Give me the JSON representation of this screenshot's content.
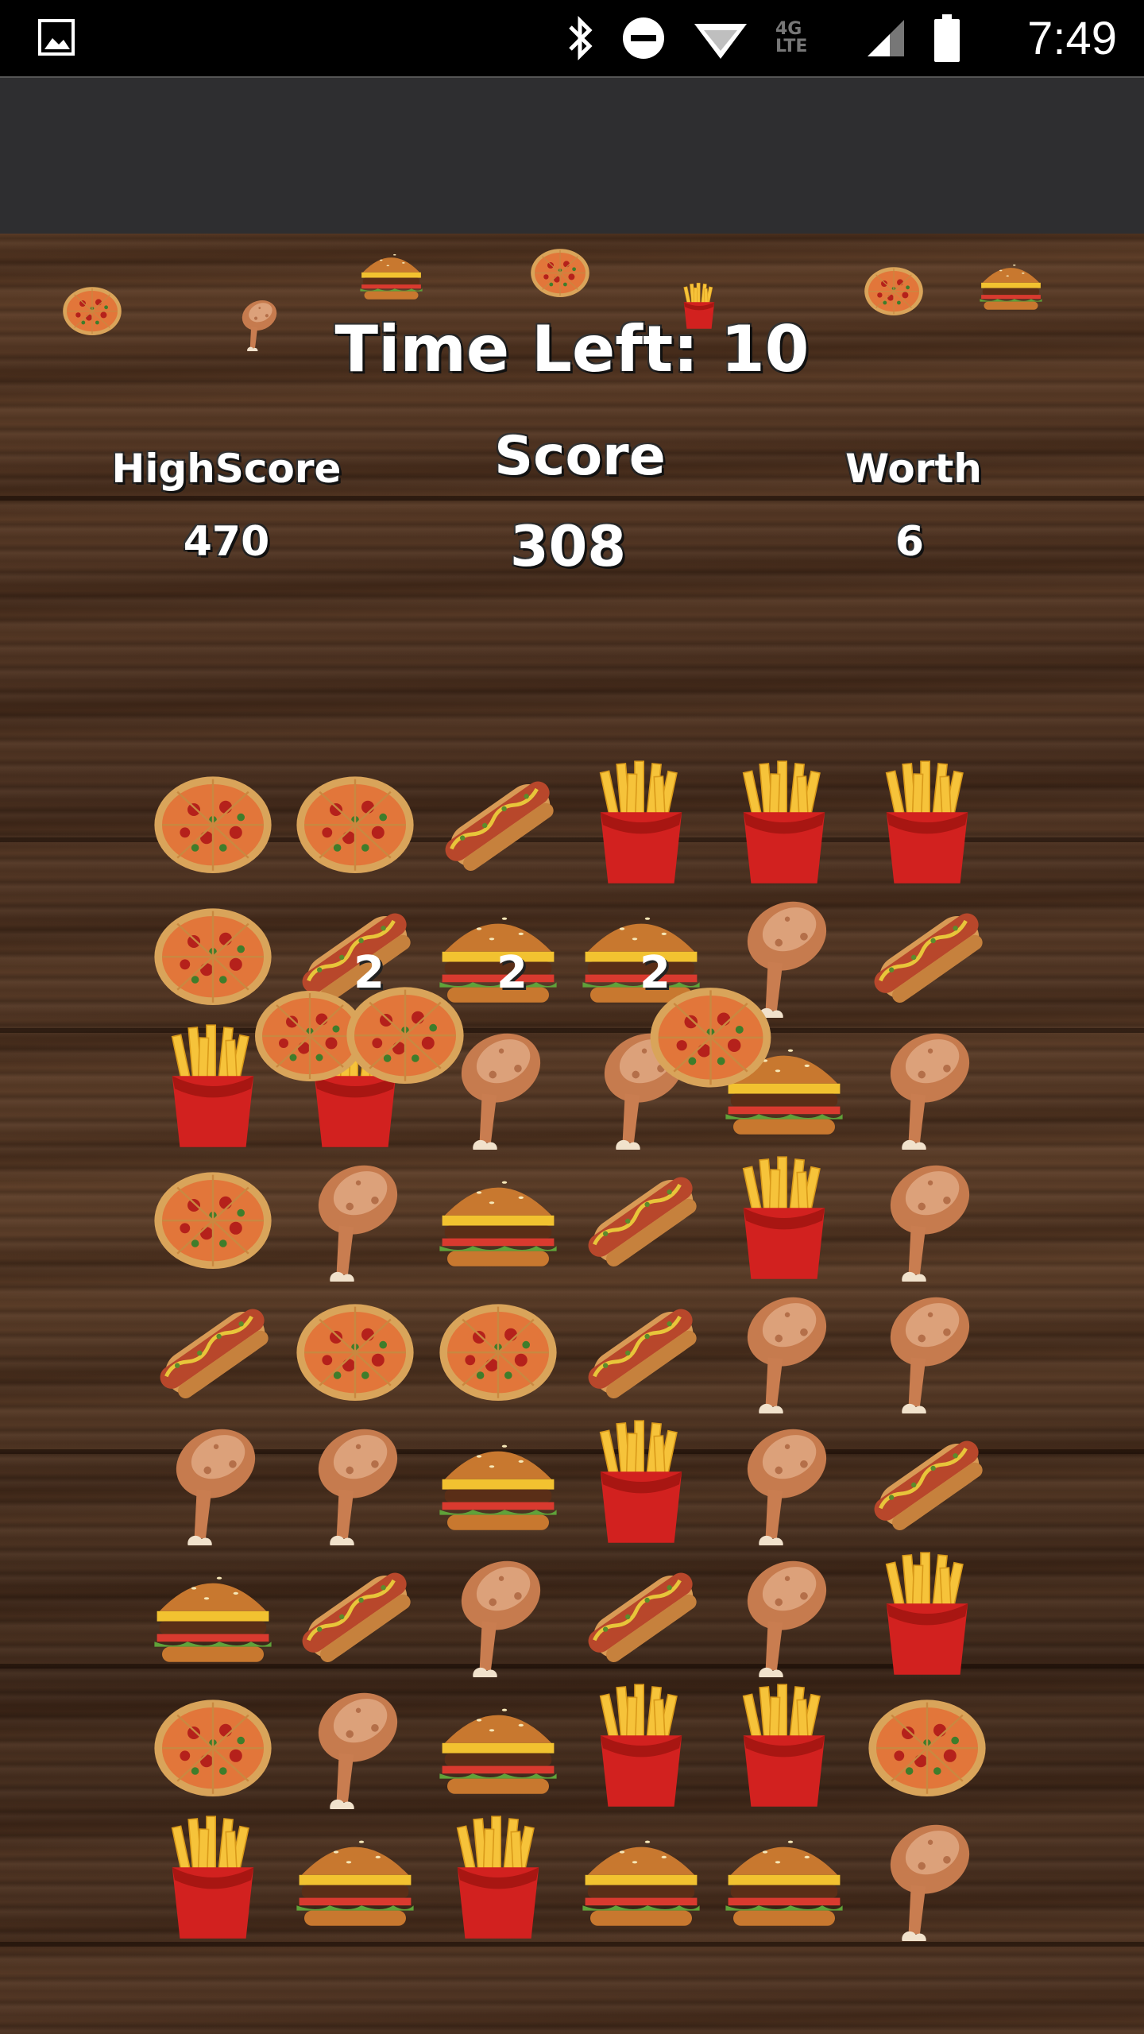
{
  "status_bar": {
    "time": "7:49",
    "network": "4G LTE",
    "icons": [
      "gallery-icon",
      "bluetooth-icon",
      "do-not-disturb-icon",
      "wifi-icon",
      "signal-icon",
      "battery-icon"
    ]
  },
  "hud": {
    "time_left": "Time Left: 10",
    "highscore_label": "HighScore",
    "highscore_value": "470",
    "score_label": "Score",
    "score_value": "308",
    "worth_label": "Worth",
    "worth_value": "6"
  },
  "popups": [
    "2",
    "2",
    "2"
  ],
  "board": {
    "rows": [
      [
        "pizza",
        "pizza",
        "hotdog",
        "fries",
        "fries",
        "fries"
      ],
      [
        "pizza",
        "hotdog",
        "burger",
        "burger",
        "chicken",
        "hotdog"
      ],
      [
        "fries",
        "fries",
        "chicken",
        "chicken",
        "burger",
        "chicken"
      ],
      [
        "pizza",
        "chicken",
        "burger",
        "hotdog",
        "fries",
        "chicken"
      ],
      [
        "hotdog",
        "pizza",
        "pizza",
        "hotdog",
        "chicken",
        "chicken"
      ],
      [
        "chicken",
        "chicken",
        "burger",
        "fries",
        "chicken",
        "hotdog"
      ],
      [
        "burger",
        "hotdog",
        "chicken",
        "hotdog",
        "chicken",
        "fries"
      ],
      [
        "pizza",
        "chicken",
        "burger",
        "fries",
        "fries",
        "pizza"
      ],
      [
        "fries",
        "burger",
        "fries",
        "burger",
        "burger",
        "chicken"
      ]
    ]
  },
  "falling_items": [
    "pizza",
    "chicken",
    "burger",
    "pizza",
    "fries",
    "pizza",
    "burger"
  ],
  "moving_items": [
    "pizza",
    "pizza",
    "pizza"
  ]
}
